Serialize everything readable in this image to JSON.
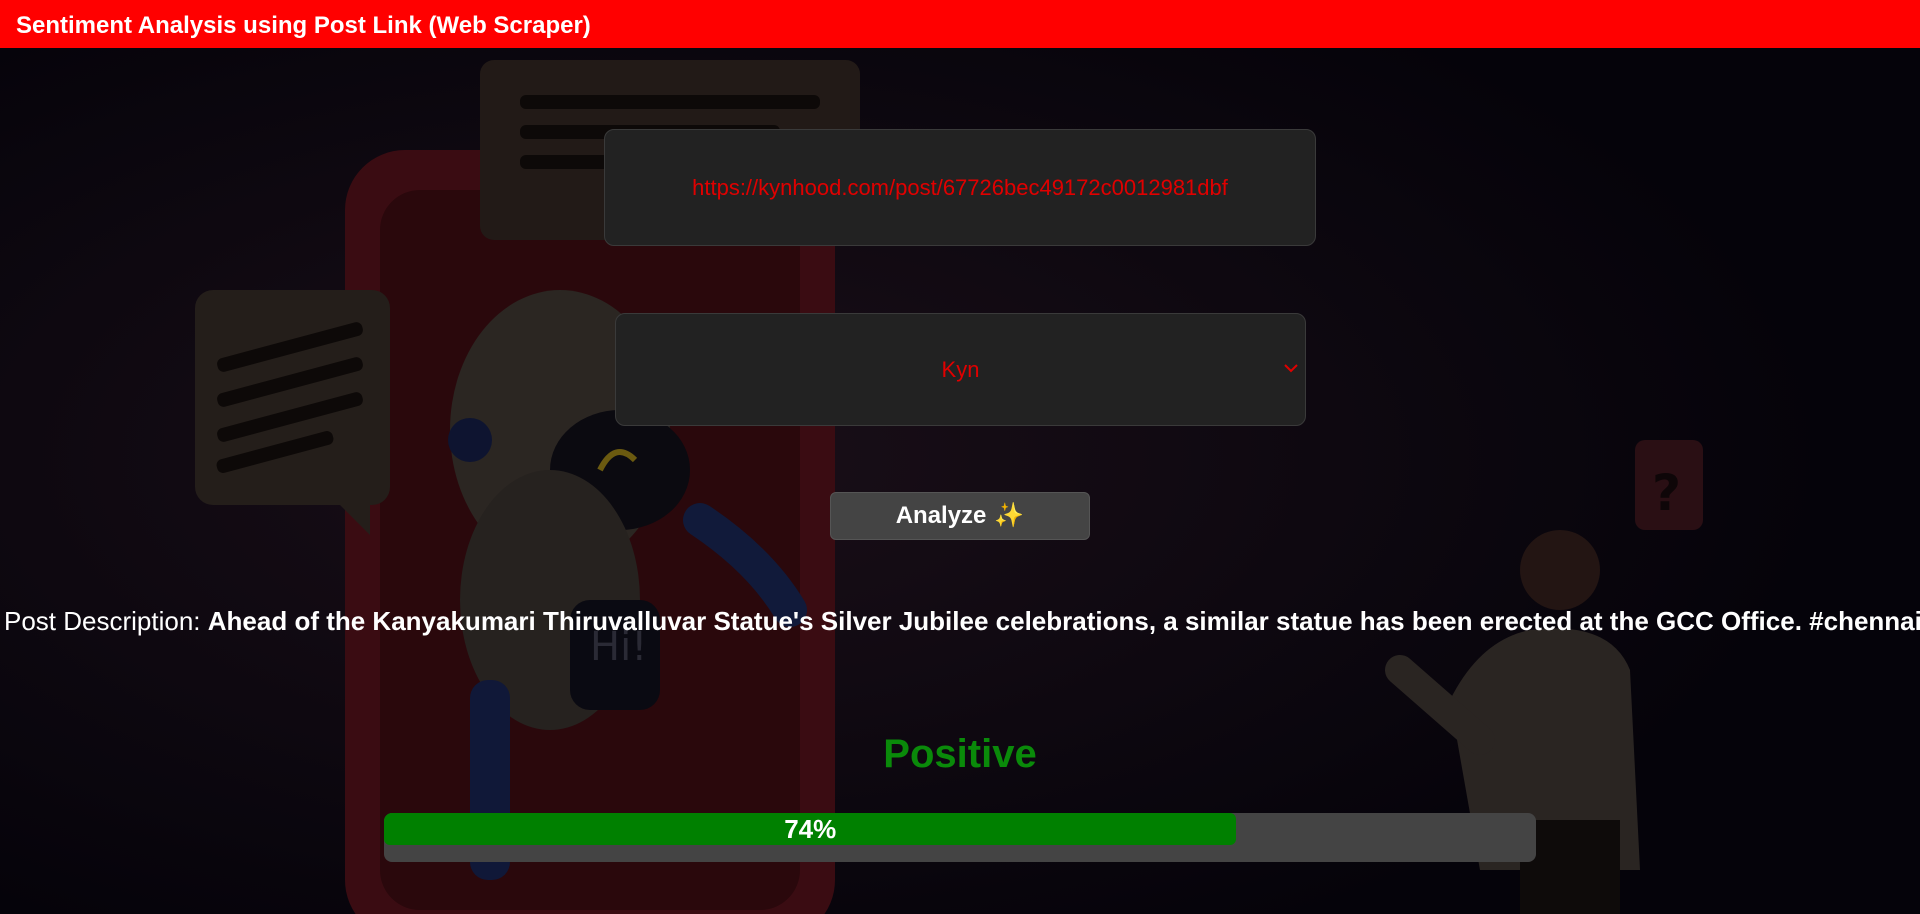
{
  "app": {
    "title": "Sentiment Analysis using Post Link (Web Scraper)"
  },
  "form": {
    "url_value": "https://kynhood.com/post/67726bec49172c0012981dbf",
    "platform_selected": "Kyn",
    "analyze_label": "Analyze",
    "analyze_icon": "✨"
  },
  "result": {
    "description_label": "Post Description:",
    "description_text": "Ahead of the Kanyakumari Thiruvalluvar Statue's Silver Jubilee celebrations, a similar statue has been erected at the GCC Office. #chennai",
    "sentiment": "Positive",
    "confidence_percent": 74,
    "confidence_label": "74%"
  },
  "colors": {
    "header": "#ff0000",
    "accent_text": "#e00000",
    "positive": "#0a8a0a",
    "progress_fill": "#008000",
    "progress_track": "#444444"
  }
}
